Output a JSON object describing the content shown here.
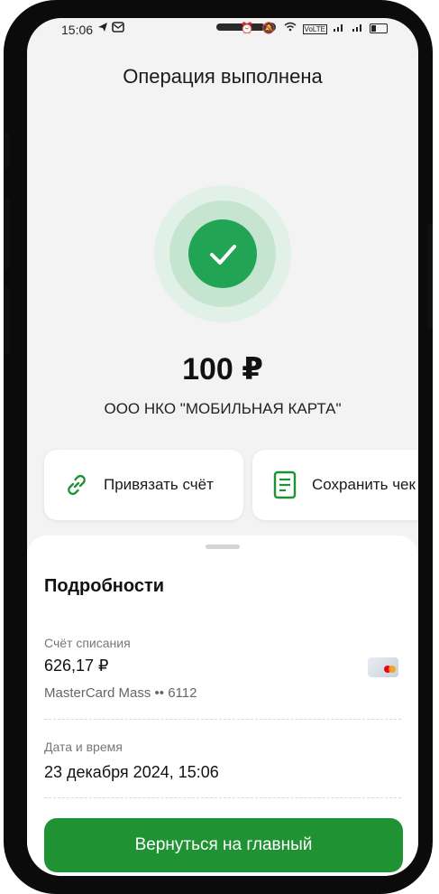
{
  "status_bar": {
    "time": "15:06",
    "left_icons": [
      "send-icon",
      "mail-icon"
    ],
    "right_icons": [
      "alarm-icon",
      "mute-icon",
      "wifi-icon",
      "volte-icon",
      "signal-icon",
      "signal-icon",
      "battery-icon"
    ],
    "volte": "VoLTE"
  },
  "header": {
    "title": "Операция выполнена"
  },
  "payment": {
    "amount": "100 ₽",
    "recipient": "ООО НКО \"МОБИЛЬНАЯ КАРТА\""
  },
  "actions": [
    {
      "label": "Привязать счёт",
      "icon": "link-icon"
    },
    {
      "label": "Сохранить чек",
      "icon": "receipt-icon"
    }
  ],
  "details": {
    "title": "Подробности",
    "account_label": "Счёт списания",
    "account_balance": "626,17 ₽",
    "card_name": "MasterCard Mass •• 6112",
    "datetime_label": "Дата и время",
    "datetime_value": "23 декабря 2024, 15:06"
  },
  "primary_button": {
    "label": "Вернуться на главный"
  },
  "colors": {
    "accent": "#21a453",
    "button": "#1f9234",
    "background": "#f3f3f3"
  }
}
